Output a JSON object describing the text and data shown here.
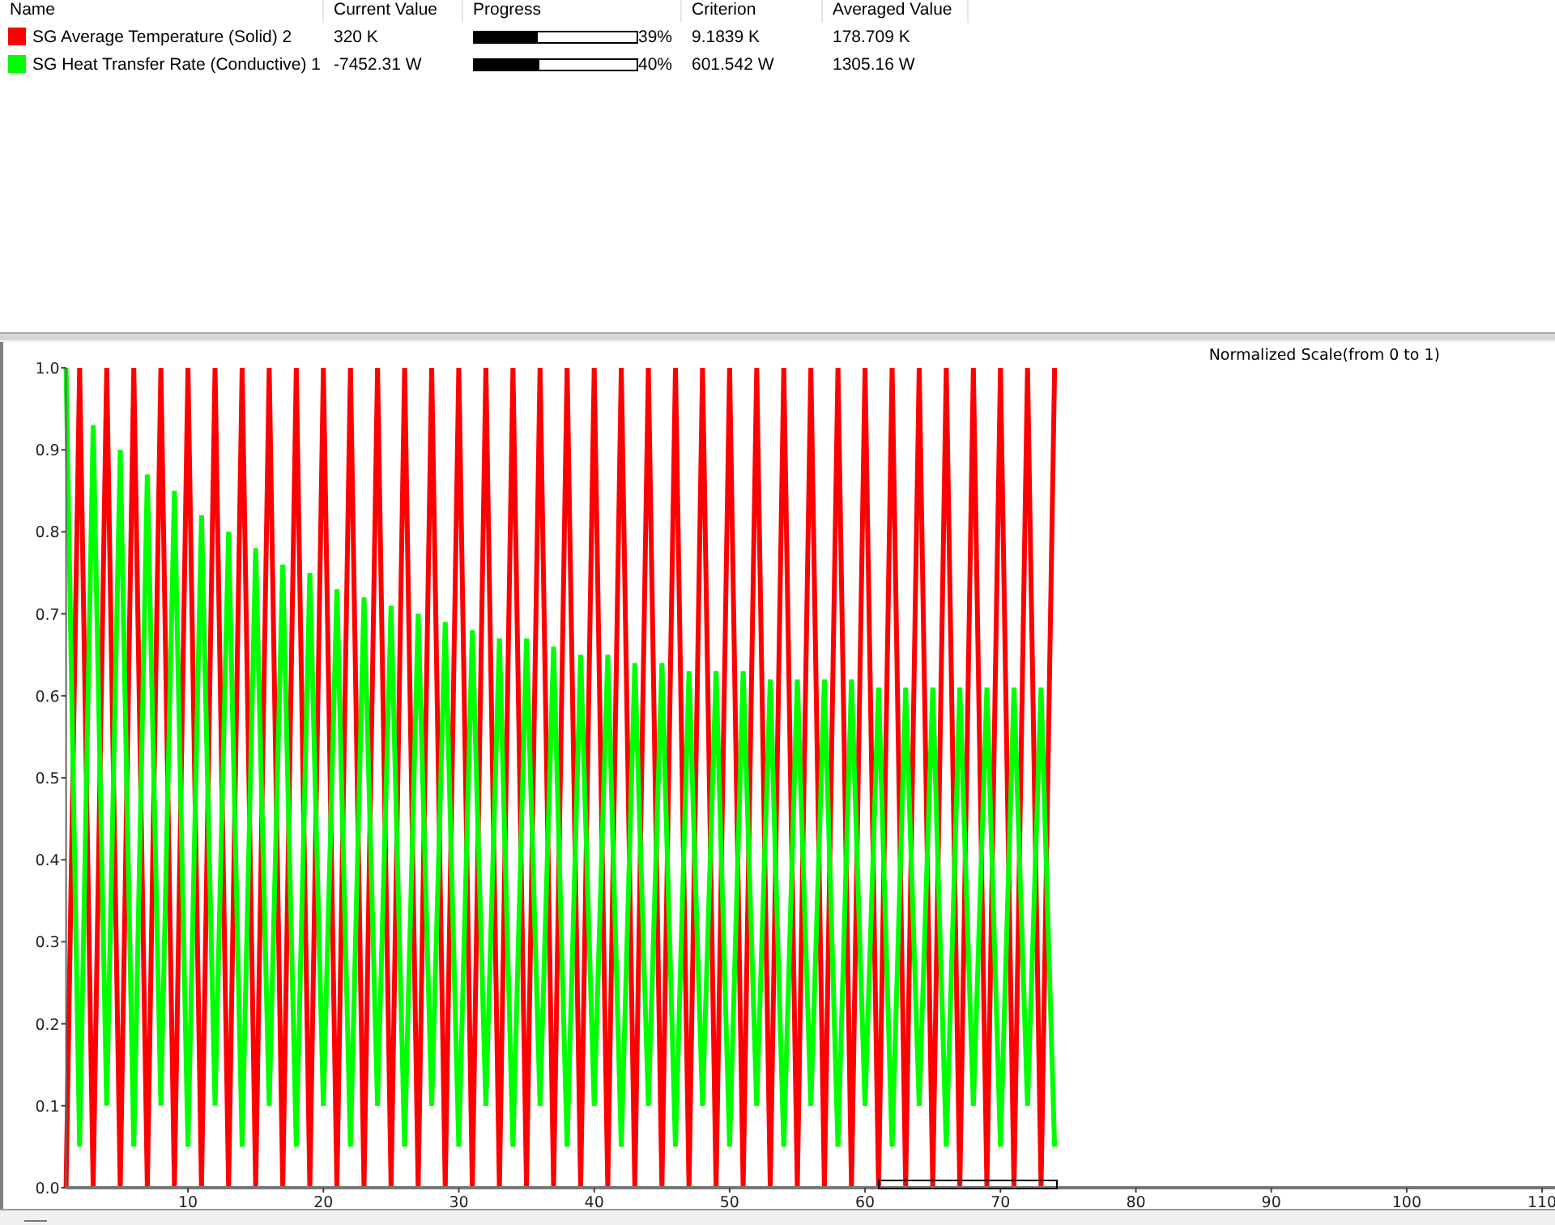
{
  "monitor_table": {
    "columns": [
      "Name",
      "Current Value",
      "Progress",
      "Criterion",
      "Averaged Value"
    ],
    "rows": [
      {
        "name": "SG Average Temperature (Solid) 2",
        "color": "#ff0000",
        "current_value": "320 K",
        "level": 0.39,
        "progress": "39%",
        "criterion": "9.1839 K",
        "averaged_value": "178.709 K"
      },
      {
        "name": "SG Heat Transfer Rate (Conductive) 1",
        "color": "#00ff00",
        "current_value": "-7452.31 W",
        "level": 0.4,
        "progress": "40%",
        "criterion": "601.542 W",
        "averaged_value": "1305.16 W"
      }
    ]
  },
  "chart": {
    "chart_data": {
      "type": "line",
      "title": "Normalized Scale(from 0 to 1)",
      "x": [
        1,
        2,
        3,
        4,
        5,
        6,
        7,
        8,
        9,
        10,
        11,
        12,
        13,
        14,
        15,
        16,
        17,
        18,
        19,
        20,
        21,
        22,
        23,
        24,
        25,
        26,
        27,
        28,
        29,
        30,
        31,
        32,
        33,
        34,
        35,
        36,
        37,
        38,
        39,
        40,
        41,
        42,
        43,
        44,
        45,
        46,
        47,
        48,
        49,
        50,
        51,
        52,
        53,
        54,
        55,
        56,
        57,
        58,
        59,
        60,
        61,
        62,
        63,
        64,
        65,
        66,
        67,
        68,
        69,
        70,
        71,
        72,
        73,
        74
      ],
      "series": [
        {
          "color": "#ff0000",
          "values": [
            0,
            1,
            0,
            1,
            0,
            1,
            0,
            1,
            0,
            1,
            0,
            1,
            0,
            1,
            0,
            1,
            0,
            1,
            0,
            1,
            0,
            1,
            0,
            1,
            0,
            1,
            0,
            1,
            0,
            1,
            0,
            1,
            0,
            1,
            0,
            1,
            0,
            1,
            0,
            1,
            0,
            1,
            0,
            1,
            0,
            1,
            0,
            1,
            0,
            1,
            0,
            1,
            0,
            1,
            0,
            1,
            0,
            1,
            0,
            1,
            0,
            1,
            0,
            1,
            0,
            1,
            0,
            1,
            0,
            1,
            0,
            1,
            0,
            1
          ]
        },
        {
          "color": "#00ff00",
          "values": [
            1.0,
            0.05,
            0.93,
            0.1,
            0.9,
            0.05,
            0.87,
            0.1,
            0.85,
            0.05,
            0.82,
            0.1,
            0.8,
            0.05,
            0.78,
            0.1,
            0.76,
            0.05,
            0.75,
            0.1,
            0.73,
            0.05,
            0.72,
            0.1,
            0.71,
            0.05,
            0.7,
            0.1,
            0.69,
            0.05,
            0.68,
            0.1,
            0.67,
            0.05,
            0.67,
            0.1,
            0.66,
            0.05,
            0.65,
            0.1,
            0.65,
            0.05,
            0.64,
            0.1,
            0.64,
            0.05,
            0.63,
            0.1,
            0.63,
            0.05,
            0.63,
            0.1,
            0.62,
            0.05,
            0.62,
            0.1,
            0.62,
            0.05,
            0.62,
            0.1,
            0.61,
            0.05,
            0.61,
            0.1,
            0.61,
            0.05,
            0.61,
            0.1,
            0.61,
            0.05,
            0.61,
            0.1,
            0.61,
            0.05
          ]
        }
      ],
      "xlim": [
        1,
        111
      ],
      "ylim": [
        0,
        1
      ],
      "xticks": [
        10,
        20,
        30,
        40,
        50,
        60,
        70,
        80,
        90,
        100,
        110
      ],
      "yticks": [
        {
          "value": 0,
          "label": "0.0"
        },
        {
          "value": 0.1,
          "label": "0.1"
        },
        {
          "value": 0.2,
          "label": "0.2"
        },
        {
          "value": 0.3,
          "label": "0.3"
        },
        {
          "value": 0.4,
          "label": "0.4"
        },
        {
          "value": 0.5,
          "label": "0.5"
        },
        {
          "value": 0.6,
          "label": "0.6"
        },
        {
          "value": 0.7,
          "label": "0.7"
        },
        {
          "value": 0.8,
          "label": "0.8"
        },
        {
          "value": 0.9,
          "label": "0.9"
        },
        {
          "value": 1,
          "label": "1.0"
        }
      ]
    }
  }
}
